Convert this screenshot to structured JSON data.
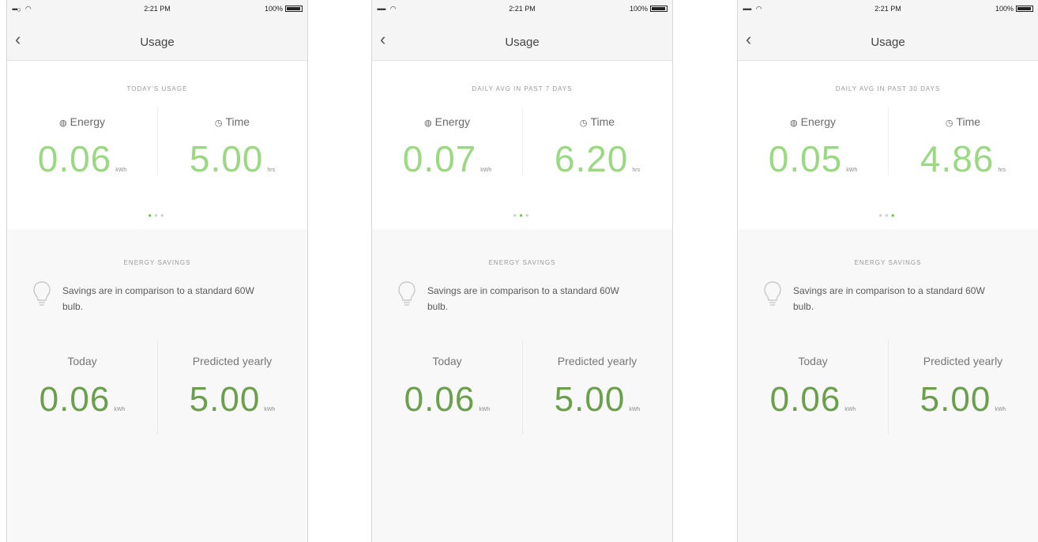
{
  "screens": [
    {
      "status": {
        "signal": "•••○ ",
        "time": "2:21 PM",
        "battery": "100%"
      },
      "nav": {
        "back_icon": "‹",
        "title": "Usage"
      },
      "period_label": "TODAY'S USAGE",
      "energy": {
        "icon": "◍",
        "label": "Energy",
        "value": "0.06",
        "unit": "kWh"
      },
      "time_metric": {
        "icon": "◷",
        "label": "Time",
        "value": "5.00",
        "unit": "hrs"
      },
      "pager": {
        "active": 0,
        "count": 3
      },
      "savings": {
        "title": "ENERGY SAVINGS",
        "note": "Savings are in comparison to a standard 60W bulb.",
        "today": {
          "label": "Today",
          "value": "0.06",
          "unit": "kWh"
        },
        "yearly": {
          "label": "Predicted yearly",
          "value": "5.00",
          "unit": "kWh"
        }
      }
    },
    {
      "status": {
        "signal": "••••• ",
        "time": "2:21 PM",
        "battery": "100%"
      },
      "nav": {
        "back_icon": "‹",
        "title": "Usage"
      },
      "period_label": "DAILY AVG IN PAST 7 DAYS",
      "energy": {
        "icon": "◍",
        "label": "Energy",
        "value": "0.07",
        "unit": "kWh"
      },
      "time_metric": {
        "icon": "◷",
        "label": "Time",
        "value": "6.20",
        "unit": "hrs"
      },
      "pager": {
        "active": 1,
        "count": 3
      },
      "savings": {
        "title": "ENERGY SAVINGS",
        "note": "Savings are in comparison to a standard 60W bulb.",
        "today": {
          "label": "Today",
          "value": "0.06",
          "unit": "kWh"
        },
        "yearly": {
          "label": "Predicted yearly",
          "value": "5.00",
          "unit": "kWh"
        }
      }
    },
    {
      "status": {
        "signal": "••••• ",
        "time": "2:21 PM",
        "battery": "100%"
      },
      "nav": {
        "back_icon": "‹",
        "title": "Usage"
      },
      "period_label": "DAILY AVG IN PAST 30 DAYS",
      "energy": {
        "icon": "◍",
        "label": "Energy",
        "value": "0.05",
        "unit": "kWh"
      },
      "time_metric": {
        "icon": "◷",
        "label": "Time",
        "value": "4.86",
        "unit": "hrs"
      },
      "pager": {
        "active": 2,
        "count": 3
      },
      "savings": {
        "title": "ENERGY SAVINGS",
        "note": "Savings are in comparison to a standard 60W bulb.",
        "today": {
          "label": "Today",
          "value": "0.06",
          "unit": "kWh"
        },
        "yearly": {
          "label": "Predicted yearly",
          "value": "5.00",
          "unit": "kWh"
        }
      }
    }
  ],
  "colors": {
    "accent_light_green": "#9bd882",
    "accent_dark_green": "#6aa04c",
    "pager_active": "#7bbf58",
    "pager_inactive": "#cfcfcf",
    "nav_background": "#f5f5f5",
    "savings_background": "#f8f8f8"
  }
}
